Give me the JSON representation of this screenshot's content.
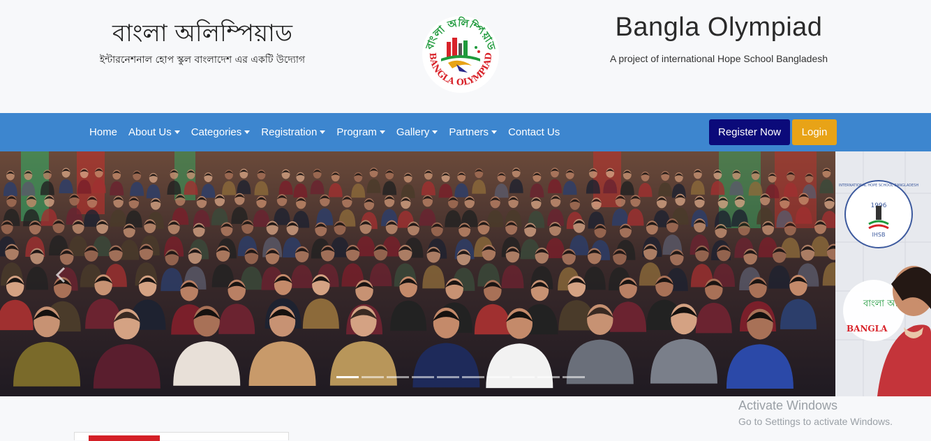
{
  "header": {
    "bn_title": "বাংলা অলিম্পিয়াড",
    "bn_subtitle": "ইন্টারনেশনাল হোপ স্কুল বাংলাদেশ এর একটি উদ্যোগ",
    "en_title": "Bangla Olympiad",
    "en_subtitle": "A project of international Hope School Bangladesh",
    "logo": {
      "icon": "bangla-olympiad-logo",
      "top_text": "বাংলা অলিম্পিয়াড",
      "bottom_text": "BANGLA OLYMPIAD",
      "colors": {
        "green": "#1f9a3c",
        "red": "#d8232a"
      }
    }
  },
  "nav": {
    "items": [
      {
        "label": "Home",
        "dropdown": false
      },
      {
        "label": "About Us",
        "dropdown": true
      },
      {
        "label": "Categories",
        "dropdown": true
      },
      {
        "label": "Registration",
        "dropdown": true
      },
      {
        "label": "Program",
        "dropdown": true
      },
      {
        "label": "Gallery",
        "dropdown": true
      },
      {
        "label": "Partners",
        "dropdown": true
      },
      {
        "label": "Contact Us",
        "dropdown": false
      }
    ],
    "register_label": "Register Now",
    "login_label": "Login",
    "colors": {
      "bar": "#3d86cf",
      "register": "#0b0a7a",
      "login": "#e8a317"
    }
  },
  "carousel": {
    "slide_count": 10,
    "active_index": 0,
    "prev_icon": "chevron-left-icon",
    "side_slide": {
      "badge_text": "INTERNATIONAL HOPE SCHOOL BANGLADESH",
      "badge_year": "1996",
      "badge_abbr": "IHSB",
      "partial_logo_text": "বাংলা অলিম্পিয়াড",
      "partial_logo_text_en": "BANGLA"
    }
  },
  "watermark": {
    "line1": "Activate Windows",
    "line2": "Go to Settings to activate Windows."
  }
}
